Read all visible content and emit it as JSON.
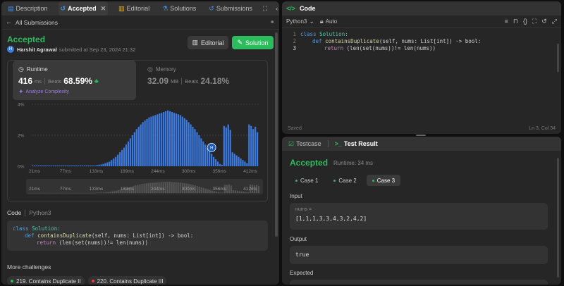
{
  "left": {
    "tabs": [
      {
        "label": "Description",
        "icon": "description-icon"
      },
      {
        "label": "Accepted",
        "icon": "history-icon"
      },
      {
        "label": "Editorial",
        "icon": "book-icon"
      },
      {
        "label": "Solutions",
        "icon": "flask-icon"
      },
      {
        "label": "Submissions",
        "icon": "history-icon"
      }
    ],
    "back_label": "All Submissions",
    "status": "Accepted",
    "user_initial": "H",
    "user_name": "Harshit Agrawal",
    "submitted_text": "submitted at Sep 23, 2024 21:32",
    "editorial_button": "Editorial",
    "solution_button": "Solution",
    "runtime": {
      "label": "Runtime",
      "value": "416",
      "unit": "ms",
      "beats_label": "Beats",
      "beats": "68.59%",
      "analyze": "Analyze Complexity"
    },
    "memory": {
      "label": "Memory",
      "value": "32.09",
      "unit": "MB",
      "beats_label": "Beats",
      "beats": "24.18%"
    },
    "code_label": "Code",
    "lang": "Python3",
    "more_challenges": "More challenges",
    "challenges": [
      {
        "label": "219. Contains Duplicate II",
        "color": "#f8b500"
      },
      {
        "label": "220. Contains Duplicate III",
        "color": "#f63737"
      }
    ]
  },
  "chart_data": {
    "type": "bar",
    "ytick_labels": [
      "0%",
      "2%",
      "4%"
    ],
    "ylim": [
      0,
      4
    ],
    "xtick_labels": [
      "21ms",
      "77ms",
      "133ms",
      "189ms",
      "244ms",
      "300ms",
      "356ms",
      "412ms"
    ],
    "values": [
      0.05,
      0.05,
      0.05,
      0.05,
      0.05,
      0.05,
      0.05,
      0.05,
      0.05,
      0.05,
      0.05,
      0.05,
      0.05,
      0.05,
      0.05,
      0.05,
      0.05,
      0.05,
      0.05,
      0.05,
      0.05,
      0.05,
      0.05,
      0.05,
      0.05,
      0.05,
      0.05,
      0.05,
      0.05,
      0.05,
      0.05,
      0.08,
      0.1,
      0.12,
      0.15,
      0.2,
      0.25,
      0.3,
      0.4,
      0.5,
      0.6,
      0.75,
      0.9,
      1.05,
      1.2,
      1.4,
      1.6,
      1.8,
      2.0,
      2.2,
      2.4,
      2.55,
      2.7,
      2.85,
      2.95,
      3.05,
      3.15,
      3.2,
      3.25,
      3.3,
      3.35,
      3.4,
      3.45,
      3.5,
      3.55,
      3.6,
      3.55,
      3.5,
      3.45,
      3.4,
      3.35,
      3.3,
      3.2,
      3.1,
      3.0,
      2.85,
      2.7,
      2.55,
      2.4,
      2.2,
      2.0,
      1.8,
      1.6,
      1.4,
      1.2,
      1.0,
      0.8,
      0.6,
      0.45,
      0.3,
      0.15,
      0.1,
      2.6,
      2.5,
      2.7,
      2.35,
      0.9,
      0.8,
      0.7,
      0.6,
      0.5,
      0.4,
      0.3,
      0.2,
      2.7,
      2.6,
      2.4,
      2.55,
      2.2
    ],
    "highlight_index": 86,
    "highlight_initial": "H",
    "bar_color": "#3b7de8",
    "highlight_color": "#1e5bbd"
  },
  "code_snippet": {
    "line1_kw": "class",
    "line1_name": "Solution:",
    "line2_kw": "def",
    "line2_fn": "containsDuplicate",
    "line2_rest": "(self, nums: List[int]) -> bool:",
    "line3_kw": "return",
    "line3_rest": "(len(set(nums))!= len(nums))"
  },
  "editor": {
    "title": "Code",
    "lang": "Python3",
    "auto": "Auto",
    "saved": "Saved",
    "position": "Ln 3, Col 34",
    "line_numbers": [
      "1",
      "2",
      "3"
    ]
  },
  "result": {
    "tab_testcase": "Testcase",
    "tab_result": "Test Result",
    "status": "Accepted",
    "runtime": "Runtime: 34 ms",
    "cases": [
      "Case 1",
      "Case 2",
      "Case 3"
    ],
    "input_label": "Input",
    "input_var": "nums =",
    "input_value": "[1,1,1,3,3,4,3,2,4,2]",
    "output_label": "Output",
    "output_value": "true",
    "expected_label": "Expected"
  },
  "colors": {
    "accent_green": "#2cbb5d",
    "panel_bg": "#262626",
    "tabbar_bg": "#333333"
  }
}
